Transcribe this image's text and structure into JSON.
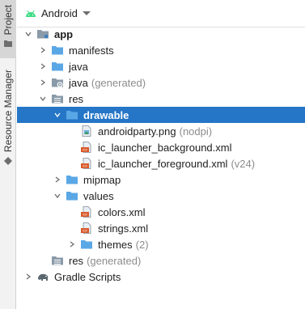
{
  "side_tabs": {
    "project": "Project",
    "resource_manager": "Resource Manager"
  },
  "header": {
    "title": "Android"
  },
  "tree": [
    {
      "label": "app",
      "suffix": "",
      "level": 0,
      "expander": "expanded",
      "icon": "module-folder-icon",
      "bold": true
    },
    {
      "label": "manifests",
      "suffix": "",
      "level": 1,
      "expander": "collapsed",
      "icon": "folder-icon",
      "bold": false
    },
    {
      "label": "java",
      "suffix": "",
      "level": 1,
      "expander": "collapsed",
      "icon": "folder-icon",
      "bold": false
    },
    {
      "label": "java",
      "suffix": "(generated)",
      "level": 1,
      "expander": "collapsed",
      "icon": "generated-folder-icon",
      "bold": false
    },
    {
      "label": "res",
      "suffix": "",
      "level": 1,
      "expander": "expanded",
      "icon": "res-folder-icon",
      "bold": false
    },
    {
      "label": "drawable",
      "suffix": "",
      "level": 2,
      "expander": "expanded",
      "icon": "folder-icon",
      "bold": true,
      "selected": true
    },
    {
      "label": "androidparty.png",
      "suffix": "(nodpi)",
      "level": 3,
      "expander": "none",
      "icon": "image-file-icon",
      "bold": false
    },
    {
      "label": "ic_launcher_background.xml",
      "suffix": "",
      "level": 3,
      "expander": "none",
      "icon": "xml-file-icon",
      "bold": false
    },
    {
      "label": "ic_launcher_foreground.xml",
      "suffix": "(v24)",
      "level": 3,
      "expander": "none",
      "icon": "xml-file-icon",
      "bold": false
    },
    {
      "label": "mipmap",
      "suffix": "",
      "level": 2,
      "expander": "collapsed",
      "icon": "folder-icon",
      "bold": false
    },
    {
      "label": "values",
      "suffix": "",
      "level": 2,
      "expander": "expanded",
      "icon": "folder-icon",
      "bold": false
    },
    {
      "label": "colors.xml",
      "suffix": "",
      "level": 3,
      "expander": "none",
      "icon": "xml-file-icon",
      "bold": false
    },
    {
      "label": "strings.xml",
      "suffix": "",
      "level": 3,
      "expander": "none",
      "icon": "xml-file-icon",
      "bold": false
    },
    {
      "label": "themes",
      "suffix": "(2)",
      "level": 3,
      "expander": "collapsed",
      "icon": "folder-icon",
      "bold": false
    },
    {
      "label": "res",
      "suffix": "(generated)",
      "level": 1,
      "expander": "none",
      "icon": "res-folder-icon",
      "bold": false
    },
    {
      "label": "Gradle Scripts",
      "suffix": "",
      "level": 0,
      "expander": "collapsed",
      "icon": "gradle-elephant-icon",
      "bold": false
    }
  ],
  "colors": {
    "selection": "#2676c7",
    "folder": "#5aa7e6",
    "xml": "#d9592a",
    "android_green": "#3ddc84",
    "muted_text": "#8c8c8c"
  }
}
